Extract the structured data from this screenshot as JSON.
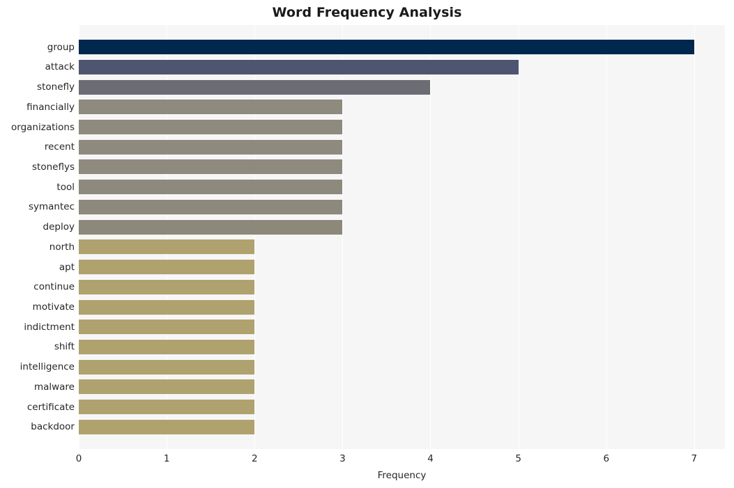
{
  "chart_data": {
    "type": "bar",
    "orientation": "horizontal",
    "title": "Word Frequency Analysis",
    "xlabel": "Frequency",
    "ylabel": "",
    "xlim": [
      0,
      7.35
    ],
    "xticks": [
      0,
      1,
      2,
      3,
      4,
      5,
      6,
      7
    ],
    "xtick_labels": [
      "0",
      "1",
      "2",
      "3",
      "4",
      "5",
      "6",
      "7"
    ],
    "grid": true,
    "grid_axis": "x",
    "legend": false,
    "categories": [
      "group",
      "attack",
      "stonefly",
      "financially",
      "organizations",
      "recent",
      "stoneflys",
      "tool",
      "symantec",
      "deploy",
      "north",
      "apt",
      "continue",
      "motivate",
      "indictment",
      "shift",
      "intelligence",
      "malware",
      "certificate",
      "backdoor"
    ],
    "values": [
      7,
      5,
      4,
      3,
      3,
      3,
      3,
      3,
      3,
      3,
      2,
      2,
      2,
      2,
      2,
      2,
      2,
      2,
      2,
      2
    ],
    "bar_colors": [
      "#00274e",
      "#4d5570",
      "#6b6d74",
      "#8e8a7d",
      "#8e8a7d",
      "#8e8a7d",
      "#8e8a7d",
      "#8d897c",
      "#8d897c",
      "#8c887a",
      "#afa26e",
      "#afa26e",
      "#afa26e",
      "#afa26e",
      "#afa26e",
      "#afa26e",
      "#afa26e",
      "#afa26e",
      "#afa26e",
      "#afa26e"
    ]
  },
  "style": {
    "plot_background": "#f6f6f7",
    "figure_background": "#ffffff",
    "gridline_color": "#ffffff",
    "text_color": "#262626",
    "title_color": "#1a1a1a"
  }
}
